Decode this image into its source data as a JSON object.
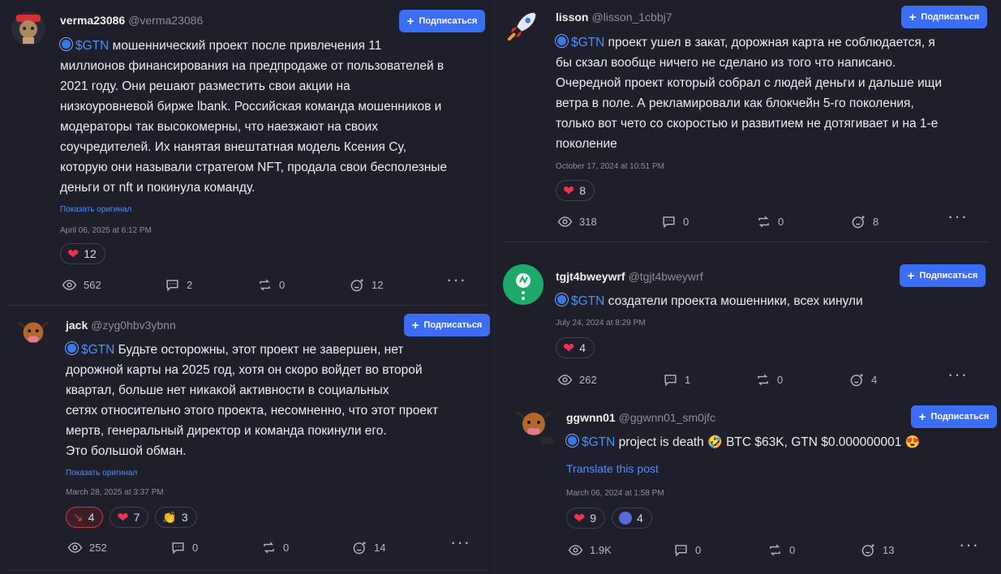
{
  "follow_label": "Подписаться",
  "show_original": "Показать оригинал",
  "translate": "Translate this post",
  "posts": [
    {
      "user": "verma23086",
      "handle": "@verma23086",
      "tag": "$GTN",
      "lines": [
        "мошеннический проект после привлечения 11",
        "миллионов финансирования на предпродаже от пользователей в",
        "2021 году. Они решают разместить свои акции на",
        "низкоуровневой бирже lbank. Российская команда мошенников и",
        "модераторы так высокомерны, что наезжают на своих",
        "соучредителей. Их нанятая внештатная модель Ксения Су,",
        "которую они называли стратегом NFT, продала свои бесполезные",
        "деньги от nft и покинула команду."
      ],
      "date": "April 06, 2025 at 6:12 PM",
      "reactions": [
        {
          "icon": "heart",
          "count": "12"
        }
      ],
      "views": "562",
      "comments": "2",
      "reposts": "0",
      "tips": "12"
    },
    {
      "user": "jack",
      "handle": "@zyg0hbv3ybnn",
      "tag": "$GTN",
      "lines": [
        "Будьте осторожны, этот проект не завершен, нет",
        "дорожной карты на 2025 год, хотя он скоро войдет во второй",
        "квартал, больше нет никакой активности в социальных",
        "сетях относительно этого проекта, несомненно, что этот проект",
        "мертв, генеральный директор и команда покинули его.",
        "Это большой обман."
      ],
      "date": "March 28, 2025 at 3:37 PM",
      "reactions": [
        {
          "icon": "trend-down",
          "count": "4"
        },
        {
          "icon": "heart",
          "count": "7"
        },
        {
          "icon": "clap",
          "count": "3"
        }
      ],
      "views": "252",
      "comments": "0",
      "reposts": "0",
      "tips": "14"
    },
    {
      "user": "lisson",
      "handle": "@lisson_1cbbj7",
      "tag": "$GTN",
      "lines": [
        "проект ушел в закат, дорожная карта не соблюдается, я",
        "бы скзал вообще ничего не сделано из того что написано.",
        "Очередной проект который собрал с людей деньги и дальше ищи",
        "ветра в поле. А рекламировали как блокчейн 5-го поколения,",
        "только вот чето со скоростью и развитием не дотягивает и на 1-е",
        "поколение"
      ],
      "date": "October 17, 2024 at 10:51 PM",
      "reactions": [
        {
          "icon": "heart",
          "count": "8"
        }
      ],
      "views": "318",
      "comments": "0",
      "reposts": "0",
      "tips": "8"
    },
    {
      "user": "tgjt4bweywrf",
      "handle": "@tgjt4bweywrf",
      "tag": "$GTN",
      "lines": [
        "создатели проекта мошенники, всех кинули"
      ],
      "date": "July 24, 2024 at 8:29 PM",
      "reactions": [
        {
          "icon": "heart",
          "count": "4"
        }
      ],
      "views": "262",
      "comments": "1",
      "reposts": "0",
      "tips": "4"
    },
    {
      "user": "ggwnn01",
      "handle": "@ggwnn01_sm0jfc",
      "tag": "$GTN",
      "text_a": "project is death",
      "text_b": "BTC $63K, GTN $0.000000001",
      "date": "March 06, 2024 at 1:58 PM",
      "reactions": [
        {
          "icon": "heart",
          "count": "9"
        },
        {
          "icon": "face",
          "count": "4"
        }
      ],
      "views": "1.9K",
      "comments": "0",
      "reposts": "0",
      "tips": "13"
    }
  ]
}
